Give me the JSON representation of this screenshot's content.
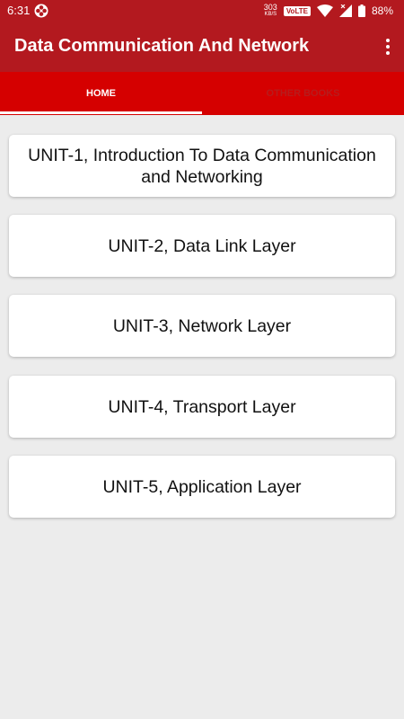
{
  "status_bar": {
    "time": "6:31",
    "app_icon": "pinwheel-icon",
    "net_speed": "303",
    "net_unit": "KB/S",
    "volte": "VoLTE",
    "wifi_icon": "wifi-icon",
    "signal_icon": "signal-icon",
    "battery_icon": "battery-icon",
    "battery": "88%"
  },
  "app_bar": {
    "title": "Data Communication And Network",
    "menu_icon": "more-vert-icon"
  },
  "tabs": [
    {
      "label": "HOME",
      "selected": true
    },
    {
      "label": "OTHER BOOKS",
      "selected": false
    }
  ],
  "units": [
    {
      "label": "UNIT-1, Introduction To Data Communication and Networking"
    },
    {
      "label": "UNIT-2, Data Link Layer"
    },
    {
      "label": "UNIT-3, Network Layer"
    },
    {
      "label": "UNIT-4, Transport Layer"
    },
    {
      "label": "UNIT-5, Application Layer"
    }
  ],
  "colors": {
    "primary_dark": "#b3191f",
    "tab_background": "#d50000",
    "background": "#ececec",
    "card": "#ffffff"
  }
}
